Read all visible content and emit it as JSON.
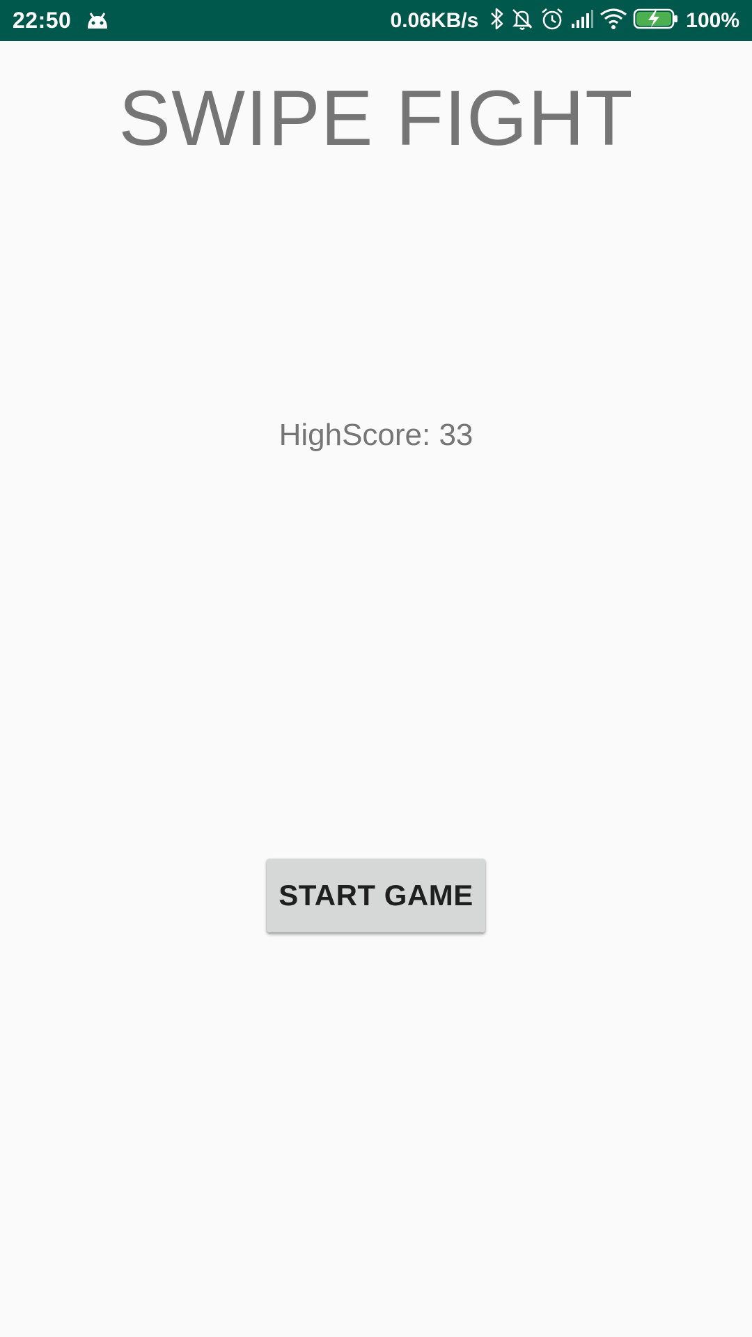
{
  "status_bar": {
    "time": "22:50",
    "network_speed": "0.06KB/s",
    "battery_percent": "100%",
    "background_color": "#00574b",
    "icons": [
      "android-icon",
      "bluetooth-icon",
      "notifications-off-icon",
      "alarm-icon",
      "signal-icon",
      "wifi-icon",
      "battery-charging-icon"
    ]
  },
  "screen": {
    "title": "SWIPE FIGHT",
    "highscore_text": "HighScore: 33",
    "start_button_label": "START GAME"
  }
}
